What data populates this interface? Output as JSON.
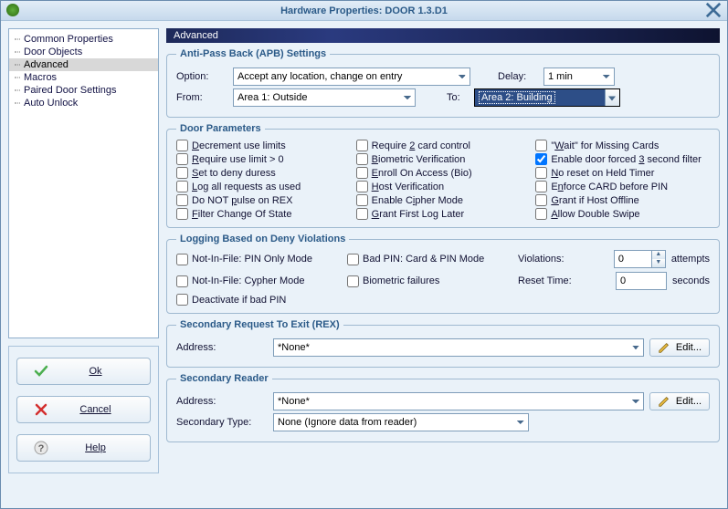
{
  "window": {
    "title": "Hardware Properties: DOOR 1.3.D1"
  },
  "nav": {
    "items": [
      "Common Properties",
      "Door Objects",
      "Advanced",
      "Macros",
      "Paired Door Settings",
      "Auto Unlock"
    ]
  },
  "buttons": {
    "ok": "Ok",
    "cancel": "Cancel",
    "help": "Help"
  },
  "main": {
    "header": "Advanced"
  },
  "apb": {
    "legend": "Anti-Pass Back (APB) Settings",
    "option_label": "Option:",
    "option_value": "Accept any location, change on entry",
    "delay_label": "Delay:",
    "delay_value": "1 min",
    "from_label": "From:",
    "from_value": "Area 1: Outside",
    "to_label": "To:",
    "to_value": "Area 2: Building"
  },
  "doorParams": {
    "legend": "Door Parameters",
    "checks": [
      {
        "label": "Decrement use limits",
        "checked": false
      },
      {
        "label": "Require 2 card control",
        "checked": false
      },
      {
        "label": "\"Wait\" for Missing Cards",
        "checked": false
      },
      {
        "label": "Require use limit > 0",
        "checked": false
      },
      {
        "label": "Biometric Verification",
        "checked": false
      },
      {
        "label": "Enable door forced 3 second filter",
        "checked": true
      },
      {
        "label": "Set to deny duress",
        "checked": false
      },
      {
        "label": "Enroll On Access (Bio)",
        "checked": false
      },
      {
        "label": "No reset on Held Timer",
        "checked": false
      },
      {
        "label": "Log all requests as used",
        "checked": false
      },
      {
        "label": "Host Verification",
        "checked": false
      },
      {
        "label": "Enforce CARD before PIN",
        "checked": false
      },
      {
        "label": "Do NOT pulse on REX",
        "checked": false
      },
      {
        "label": "Enable Cipher Mode",
        "checked": false
      },
      {
        "label": "Grant if Host Offline",
        "checked": false
      },
      {
        "label": "Filter Change Of State",
        "checked": false
      },
      {
        "label": "Grant First Log Later",
        "checked": false
      },
      {
        "label": "Allow Double Swipe",
        "checked": false
      }
    ]
  },
  "logging": {
    "legend": "Logging Based on Deny Violations",
    "checks": [
      "Not-In-File: PIN Only Mode",
      "Bad PIN: Card & PIN Mode",
      "Not-In-File: Cypher Mode",
      "Biometric failures",
      "Deactivate if bad PIN"
    ],
    "violations_label": "Violations:",
    "violations_value": "0",
    "violations_unit": "attempts",
    "reset_label": "Reset Time:",
    "reset_value": "0",
    "reset_unit": "seconds"
  },
  "rex": {
    "legend": "Secondary Request To Exit (REX)",
    "address_label": "Address:",
    "address_value": "*None*",
    "edit_label": "Edit..."
  },
  "reader": {
    "legend": "Secondary Reader",
    "address_label": "Address:",
    "address_value": "*None*",
    "edit_label": "Edit...",
    "sectype_label": "Secondary Type:",
    "sectype_value": "None (Ignore data from reader)"
  }
}
